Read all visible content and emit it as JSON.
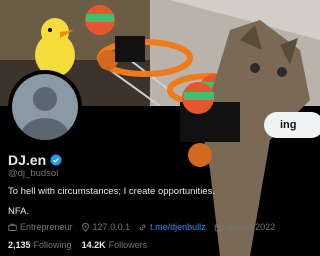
{
  "profile": {
    "display_name": "DJ.en",
    "handle": "@dj_budsol",
    "bio_line1": "To hell with circumstances; I create opportunities.",
    "bio_line2": "NFA.",
    "category": "Entrepreneur",
    "location": "127.0.0.1",
    "link": "t.me/djenbullz",
    "joined": "Joined",
    "joined_year": "2022"
  },
  "counts": {
    "following_count": "2,135",
    "following_label": "Following",
    "followers_count": "14.2K",
    "followers_label": "Followers"
  },
  "actions": {
    "follow_label": "ing"
  },
  "colors": {
    "accent": "#1d9bf0",
    "background": "#000000",
    "secondary_text": "#71767b"
  }
}
